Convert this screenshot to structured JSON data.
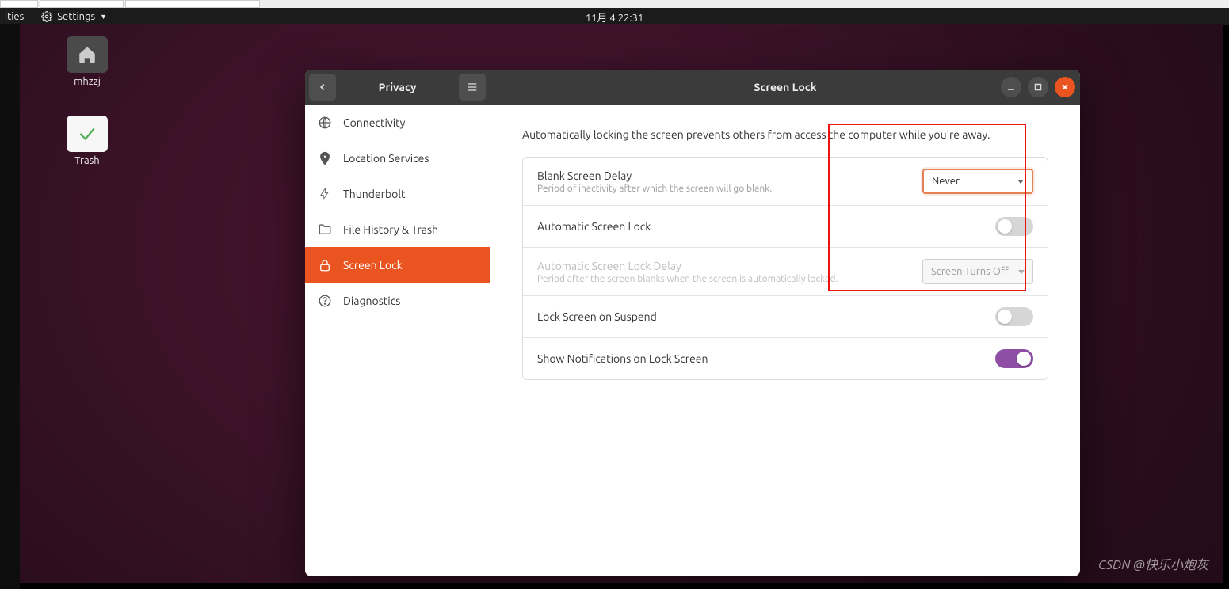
{
  "top_panel": {
    "activities_cutoff": "ities",
    "app_menu": "Settings",
    "clock": "11月 4  22:31"
  },
  "desktop": {
    "home_label": "mhzzj",
    "trash_label": "Trash"
  },
  "window": {
    "left_title": "Privacy",
    "right_title": "Screen Lock"
  },
  "sidebar": {
    "items": [
      {
        "label": "Connectivity"
      },
      {
        "label": "Location Services"
      },
      {
        "label": "Thunderbolt"
      },
      {
        "label": "File History & Trash"
      },
      {
        "label": "Screen Lock"
      },
      {
        "label": "Diagnostics"
      }
    ]
  },
  "content": {
    "intro": "Automatically locking the screen prevents others from access the computer while you're away.",
    "rows": {
      "blank_delay": {
        "title": "Blank Screen Delay",
        "sub": "Period of inactivity after which the screen will go blank.",
        "value": "Never"
      },
      "auto_lock": {
        "title": "Automatic Screen Lock"
      },
      "auto_lock_delay": {
        "title": "Automatic Screen Lock Delay",
        "sub": "Period after the screen blanks when the screen is automatically locked.",
        "value": "Screen Turns Off"
      },
      "suspend": {
        "title": "Lock Screen on Suspend"
      },
      "notifications": {
        "title": "Show Notifications on Lock Screen"
      }
    }
  },
  "watermark": "CSDN @快乐小炮灰"
}
